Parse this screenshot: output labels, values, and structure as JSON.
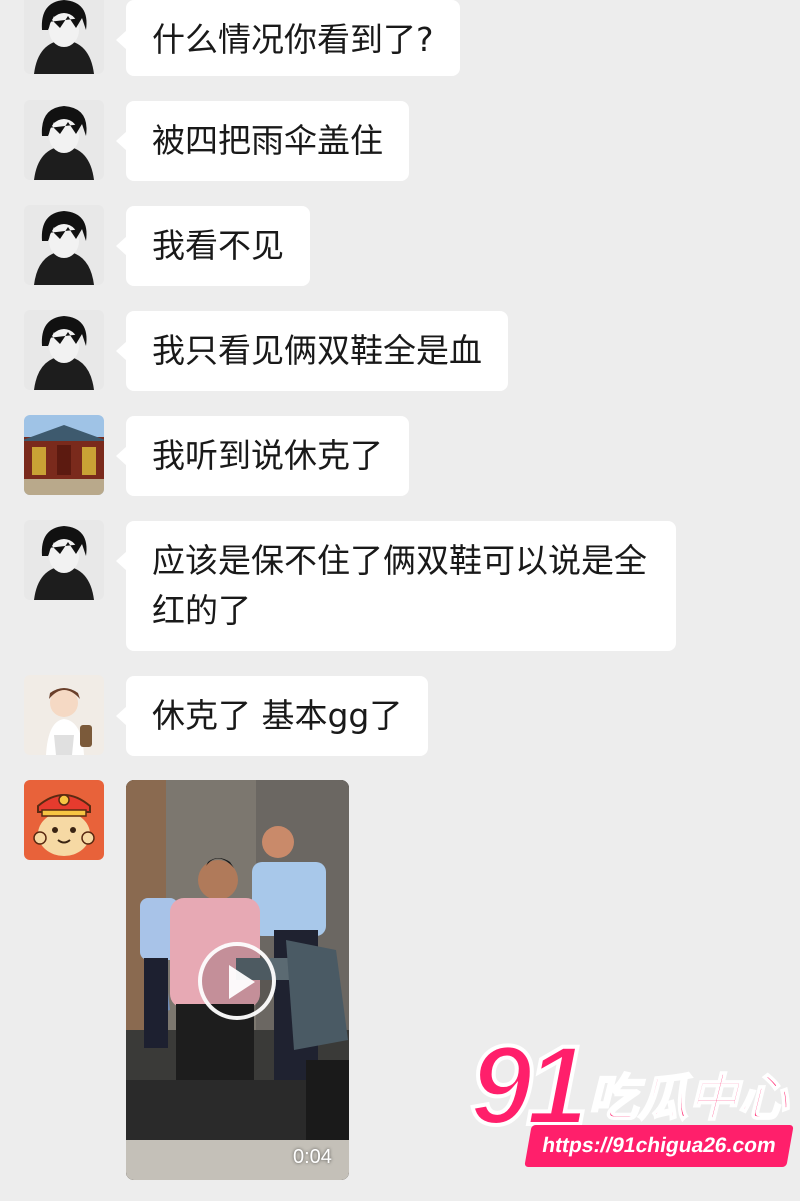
{
  "messages": [
    {
      "avatar": "anime-boy-avatar",
      "text": "什么情况你看到了?"
    },
    {
      "avatar": "anime-boy-avatar",
      "text": "被四把雨伞盖住"
    },
    {
      "avatar": "anime-boy-avatar",
      "text": "我看不见"
    },
    {
      "avatar": "anime-boy-avatar",
      "text": "我只看见俩双鞋全是血"
    },
    {
      "avatar": "temple-avatar",
      "text": "我听到说休克了"
    },
    {
      "avatar": "anime-boy-avatar",
      "text": "应该是保不住了俩双鞋可以说是全红的了"
    },
    {
      "avatar": "child-avatar",
      "text": "休克了  基本gg了"
    },
    {
      "avatar": "dog-cartoon-avatar",
      "video_duration": "0:04"
    }
  ],
  "watermark": {
    "number": "91",
    "brand": "吃瓜中心",
    "url": "https://91chigua26.com",
    "color": "#ff1f6b"
  }
}
